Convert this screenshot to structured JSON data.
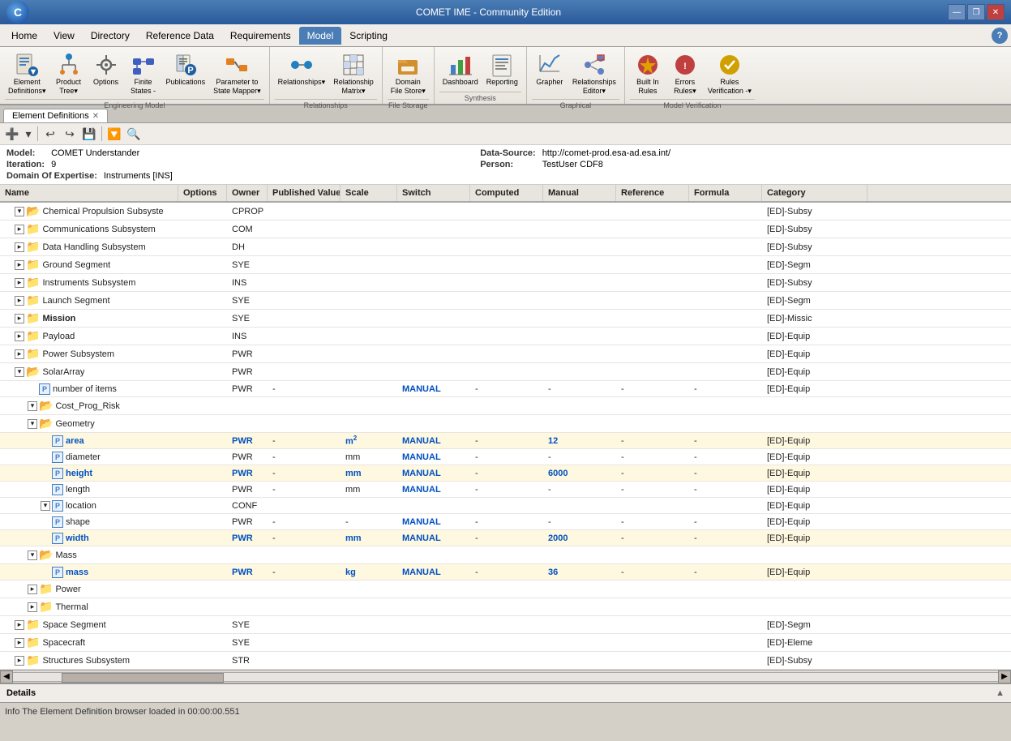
{
  "app": {
    "title": "COMET IME - Community Edition"
  },
  "titlebar": {
    "minimize_label": "—",
    "restore_label": "❐",
    "close_label": "✕"
  },
  "menubar": {
    "items": [
      "Home",
      "View",
      "Directory",
      "Reference Data",
      "Requirements",
      "Model",
      "Scripting"
    ],
    "active_index": 5
  },
  "ribbon": {
    "groups": [
      {
        "label": "Engineering Model",
        "items": [
          {
            "id": "element-definitions",
            "label": "Element\nDefinitions",
            "icon": "📋",
            "has_arrow": true
          },
          {
            "id": "product-tree",
            "label": "Product\nTree",
            "icon": "🌳",
            "has_arrow": true
          },
          {
            "id": "options",
            "label": "Options",
            "icon": "⚙️"
          },
          {
            "id": "finite-states",
            "label": "Finite\nStates -",
            "icon": "🔷"
          },
          {
            "id": "publications",
            "label": "Publications",
            "icon": "📄"
          },
          {
            "id": "parameter-state-mapper",
            "label": "Parameter to\nState Mapper",
            "icon": "🗺️",
            "has_arrow": true
          }
        ]
      },
      {
        "label": "Relationships",
        "items": [
          {
            "id": "relationships",
            "label": "Relationships",
            "icon": "🔗",
            "has_arrow": true
          },
          {
            "id": "relationship-matrix",
            "label": "Relationship\nMatrix",
            "icon": "📊",
            "has_arrow": true
          }
        ]
      },
      {
        "label": "File Storage",
        "items": [
          {
            "id": "domain-file-store",
            "label": "Domain\nFile Store",
            "icon": "💼",
            "has_arrow": true
          }
        ]
      },
      {
        "label": "Synthesis",
        "items": [
          {
            "id": "dashboard",
            "label": "Dashboard",
            "icon": "📈"
          },
          {
            "id": "reporting",
            "label": "Reporting",
            "icon": "📑"
          }
        ]
      },
      {
        "label": "Graphical",
        "items": [
          {
            "id": "grapher",
            "label": "Grapher",
            "icon": "📉"
          },
          {
            "id": "relationships-editor",
            "label": "Relationships\nEditor",
            "icon": "✏️",
            "has_arrow": true
          }
        ]
      },
      {
        "label": "Model Verification",
        "items": [
          {
            "id": "built-in-rules",
            "label": "Built In\nRules",
            "icon": "🛡️"
          },
          {
            "id": "errors-rules",
            "label": "Errors\nRules",
            "icon": "⚠️",
            "has_arrow": true
          },
          {
            "id": "rules-verification",
            "label": "Rules\nVerification -",
            "icon": "✅",
            "has_arrow": true
          }
        ]
      }
    ]
  },
  "tabs": [
    {
      "id": "element-definitions-tab",
      "label": "Element Definitions",
      "active": true,
      "closable": true
    }
  ],
  "toolbar": {
    "buttons": [
      {
        "id": "add-btn",
        "icon": "➕",
        "label": "Add"
      },
      {
        "id": "dropdown-arrow",
        "icon": "▾"
      },
      {
        "id": "undo-btn",
        "icon": "↩"
      },
      {
        "id": "redo-btn",
        "icon": "↪"
      },
      {
        "id": "save-btn",
        "icon": "💾"
      },
      {
        "id": "filter-btn",
        "icon": "🔽"
      },
      {
        "id": "search-btn",
        "icon": "🔍"
      }
    ]
  },
  "model_info": {
    "model_label": "Model:",
    "model_value": "COMET Understander",
    "data_source_label": "Data-Source:",
    "data_source_value": "http://comet-prod.esa-ad.esa.int/",
    "iteration_label": "Iteration:",
    "iteration_value": "9",
    "person_label": "Person:",
    "person_value": "TestUser CDF8",
    "domain_label": "Domain Of Expertise:",
    "domain_value": "Instruments [INS]"
  },
  "table": {
    "columns": [
      {
        "id": "name",
        "label": "Name"
      },
      {
        "id": "options",
        "label": "Options"
      },
      {
        "id": "owner",
        "label": "Owner"
      },
      {
        "id": "published-value",
        "label": "Published Value"
      },
      {
        "id": "scale",
        "label": "Scale"
      },
      {
        "id": "switch",
        "label": "Switch"
      },
      {
        "id": "computed",
        "label": "Computed"
      },
      {
        "id": "manual",
        "label": "Manual"
      },
      {
        "id": "reference",
        "label": "Reference"
      },
      {
        "id": "formula",
        "label": "Formula"
      },
      {
        "id": "category",
        "label": "Category"
      }
    ],
    "rows": [
      {
        "id": "chemical-propulsion",
        "indent": 1,
        "expand": true,
        "type": "folder",
        "name": "Chemical Propulsion Subsyste",
        "owner": "CPROP",
        "category": "[ED]-Subsy"
      },
      {
        "id": "communications",
        "indent": 1,
        "expand": false,
        "type": "folder",
        "name": "Communications Subsystem",
        "owner": "COM",
        "category": "[ED]-Subsy"
      },
      {
        "id": "data-handling",
        "indent": 1,
        "expand": false,
        "type": "folder",
        "name": "Data Handling Subsystem",
        "owner": "DH",
        "category": "[ED]-Subsy"
      },
      {
        "id": "ground-segment",
        "indent": 1,
        "expand": false,
        "type": "folder",
        "name": "Ground Segment",
        "owner": "SYE",
        "category": "[ED]-Segm"
      },
      {
        "id": "instruments-subsystem",
        "indent": 1,
        "expand": false,
        "type": "folder",
        "name": "Instruments Subsystem",
        "owner": "INS",
        "category": "[ED]-Subsy"
      },
      {
        "id": "launch-segment",
        "indent": 1,
        "expand": false,
        "type": "folder",
        "name": "Launch Segment",
        "owner": "SYE",
        "category": "[ED]-Segm"
      },
      {
        "id": "mission",
        "indent": 1,
        "expand": false,
        "type": "folder",
        "name": "Mission",
        "bold": true,
        "owner": "SYE",
        "category": "[ED]-Missic"
      },
      {
        "id": "payload",
        "indent": 1,
        "expand": false,
        "type": "folder",
        "name": "Payload",
        "owner": "INS",
        "category": "[ED]-Equip"
      },
      {
        "id": "power-subsystem",
        "indent": 1,
        "expand": false,
        "type": "folder",
        "name": "Power Subsystem",
        "owner": "PWR",
        "category": "[ED]-Equip"
      },
      {
        "id": "solar-array",
        "indent": 1,
        "expand": true,
        "type": "folder",
        "name": "SolarArray",
        "owner": "PWR",
        "category": "[ED]-Equip"
      },
      {
        "id": "number-of-items",
        "indent": 2,
        "expand": false,
        "type": "param",
        "name": "number of items",
        "owner": "PWR",
        "published_value": "-",
        "scale": "",
        "switch": "MANUAL",
        "computed": "-",
        "manual": "-",
        "reference": "-",
        "formula": "-",
        "category": "[ED]-Equip"
      },
      {
        "id": "cost-prog-risk",
        "indent": 2,
        "expand": true,
        "type": "folder",
        "name": "Cost_Prog_Risk",
        "owner": "",
        "category": ""
      },
      {
        "id": "geometry",
        "indent": 2,
        "expand": true,
        "type": "folder",
        "name": "Geometry",
        "owner": "",
        "category": ""
      },
      {
        "id": "area",
        "indent": 3,
        "expand": false,
        "type": "param",
        "name": "area",
        "highlight": true,
        "owner_blue": true,
        "owner": "PWR",
        "published_value": "-",
        "scale": "m²",
        "switch": "MANUAL",
        "computed": "-",
        "manual": "12",
        "reference": "-",
        "formula": "-",
        "category": "[ED]-Equip"
      },
      {
        "id": "diameter",
        "indent": 3,
        "expand": false,
        "type": "param",
        "name": "diameter",
        "owner": "PWR",
        "published_value": "-",
        "scale": "mm",
        "switch": "MANUAL",
        "computed": "-",
        "manual": "-",
        "reference": "-",
        "formula": "-",
        "category": "[ED]-Equip"
      },
      {
        "id": "height",
        "indent": 3,
        "expand": false,
        "type": "param",
        "name": "height",
        "highlight": true,
        "owner_blue": true,
        "owner": "PWR",
        "published_value": "-",
        "scale": "mm",
        "switch": "MANUAL",
        "computed": "-",
        "manual": "6000",
        "reference": "-",
        "formula": "-",
        "category": "[ED]-Equip"
      },
      {
        "id": "length",
        "indent": 3,
        "expand": false,
        "type": "param",
        "name": "length",
        "owner": "PWR",
        "published_value": "-",
        "scale": "mm",
        "switch": "MANUAL",
        "computed": "-",
        "manual": "-",
        "reference": "-",
        "formula": "-",
        "category": "[ED]-Equip"
      },
      {
        "id": "location",
        "indent": 3,
        "expand": true,
        "type": "param",
        "name": "location",
        "owner": "CONF",
        "published_value": "",
        "scale": "",
        "switch": "",
        "computed": "",
        "manual": "",
        "reference": "",
        "formula": "",
        "category": "[ED]-Equip"
      },
      {
        "id": "shape",
        "indent": 3,
        "expand": false,
        "type": "param",
        "name": "shape",
        "owner": "PWR",
        "published_value": "-",
        "scale": "-",
        "switch": "MANUAL",
        "computed": "-",
        "manual": "-",
        "reference": "-",
        "formula": "-",
        "category": "[ED]-Equip"
      },
      {
        "id": "width",
        "indent": 3,
        "expand": false,
        "type": "param",
        "name": "width",
        "highlight": true,
        "owner_blue": true,
        "owner": "PWR",
        "published_value": "-",
        "scale": "mm",
        "switch": "MANUAL",
        "computed": "-",
        "manual": "2000",
        "reference": "-",
        "formula": "-",
        "category": "[ED]-Equip"
      },
      {
        "id": "mass-group",
        "indent": 2,
        "expand": true,
        "type": "folder",
        "name": "Mass",
        "owner": "",
        "category": ""
      },
      {
        "id": "mass",
        "indent": 3,
        "expand": false,
        "type": "param",
        "name": "mass",
        "highlight": true,
        "owner_blue": true,
        "owner": "PWR",
        "published_value": "-",
        "scale": "kg",
        "switch": "MANUAL",
        "computed": "-",
        "manual": "36",
        "reference": "-",
        "formula": "-",
        "category": "[ED]-Equip"
      },
      {
        "id": "power",
        "indent": 2,
        "expand": false,
        "type": "folder",
        "name": "Power",
        "owner": "",
        "category": ""
      },
      {
        "id": "thermal",
        "indent": 2,
        "expand": false,
        "type": "folder",
        "name": "Thermal",
        "owner": "",
        "category": ""
      },
      {
        "id": "space-segment",
        "indent": 1,
        "expand": false,
        "type": "folder",
        "name": "Space Segment",
        "owner": "SYE",
        "category": "[ED]-Segm"
      },
      {
        "id": "spacecraft",
        "indent": 1,
        "expand": false,
        "type": "folder",
        "name": "Spacecraft",
        "owner": "SYE",
        "category": "[ED]-Eleme"
      },
      {
        "id": "structures-subsystem",
        "indent": 1,
        "expand": false,
        "type": "folder",
        "name": "Structures Subsystem",
        "owner": "STR",
        "category": "[ED]-Subsy"
      }
    ]
  },
  "details": {
    "label": "Details"
  },
  "statusbar": {
    "message": "Info  The Element Definition browser loaded in 00:00:00.551"
  }
}
